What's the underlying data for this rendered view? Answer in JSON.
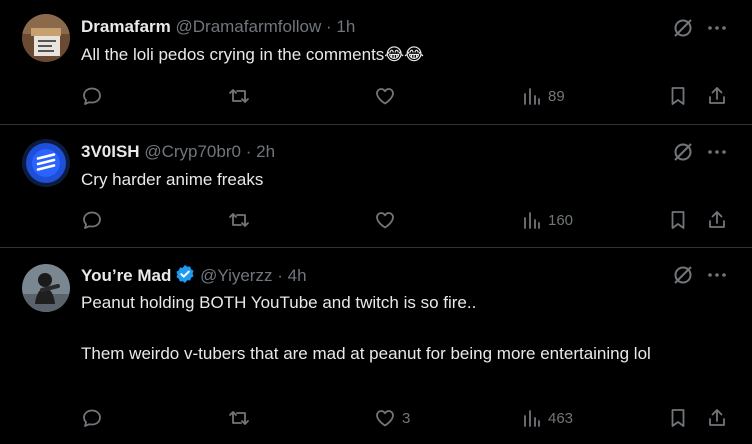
{
  "posts": [
    {
      "name": "Dramafarm",
      "handle": "@Dramafarmfollow",
      "separator": "·",
      "time": "1h",
      "text": "All the loli pedos crying in the comments😂😂",
      "replies": "",
      "reposts": "",
      "likes": "",
      "views": "89",
      "avatar_color": "#5a3a2a",
      "verified": false
    },
    {
      "name": "3V0ISH",
      "handle": "@Cryp70br0",
      "separator": "·",
      "time": "2h",
      "text": "Cry harder anime freaks",
      "replies": "",
      "reposts": "",
      "likes": "",
      "views": "160",
      "avatar_color": "#1d4ed8",
      "verified": false
    },
    {
      "name": "You’re Mad",
      "handle": "@Yiyerzz",
      "separator": "·",
      "time": "4h",
      "text_line1": "Peanut holding BOTH YouTube and twitch is so fire..",
      "text_line2": "Them weirdo v-tubers that are mad at peanut for being more entertaining lol",
      "replies": "",
      "reposts": "",
      "likes": "3",
      "views": "463",
      "avatar_color": "#5b6770",
      "verified": true
    }
  ],
  "colors": {
    "background": "#000000",
    "text": "#e7e9ea",
    "muted": "#71767b",
    "divider": "#2f3336",
    "verified": "#1d9bf0"
  },
  "icons": [
    "grok-icon",
    "more-icon",
    "reply-icon",
    "repost-icon",
    "like-icon",
    "views-icon",
    "bookmark-icon",
    "share-icon",
    "verified-icon"
  ]
}
